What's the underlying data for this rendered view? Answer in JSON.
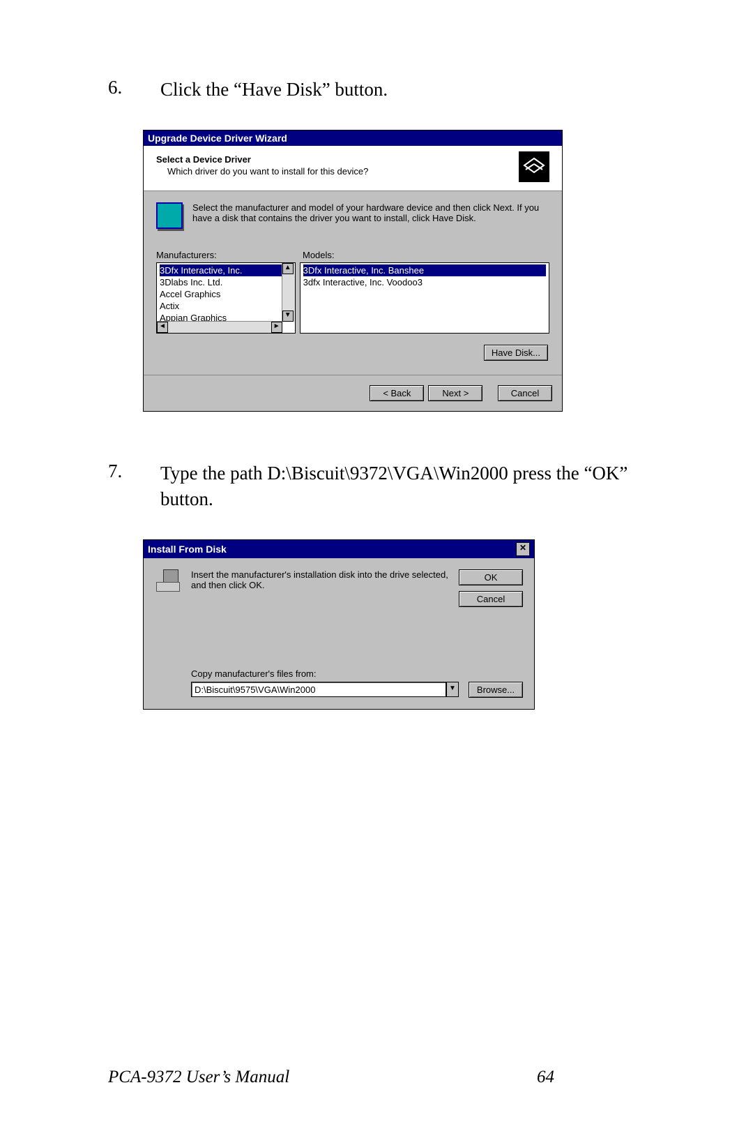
{
  "steps": {
    "s6": {
      "num": "6.",
      "text": "Click the “Have Disk” button."
    },
    "s7": {
      "num": "7.",
      "text": "Type the path D:\\Biscuit\\9372\\VGA\\Win2000  press the “OK” button."
    }
  },
  "wizard": {
    "title": "Upgrade Device Driver Wizard",
    "heading": "Select a Device Driver",
    "subheading": "Which driver do you want to install for this device?",
    "desc": "Select the manufacturer and model of your hardware device and then click Next. If you have a disk that contains the driver you want to install, click Have Disk.",
    "manufacturers_label": "Manufacturers:",
    "models_label": "Models:",
    "manufacturers": [
      "3Dfx Interactive, Inc.",
      "3Dlabs Inc. Ltd.",
      "Accel Graphics",
      "Actix",
      "Appian Graphics"
    ],
    "models": [
      "3Dfx Interactive, Inc. Banshee",
      "3dfx Interactive, Inc. Voodoo3"
    ],
    "have_disk": "Have Disk...",
    "back": "< Back",
    "next": "Next >",
    "cancel": "Cancel"
  },
  "install": {
    "title": "Install From Disk",
    "msg": "Insert the manufacturer's installation disk into the drive selected, and then click OK.",
    "ok": "OK",
    "cancel": "Cancel",
    "copy_label": "Copy manufacturer's files from:",
    "path": "D:\\Biscuit\\9575\\VGA\\Win2000",
    "browse": "Browse..."
  },
  "footer": {
    "manual": "PCA-9372 User’s Manual",
    "page": "64"
  }
}
